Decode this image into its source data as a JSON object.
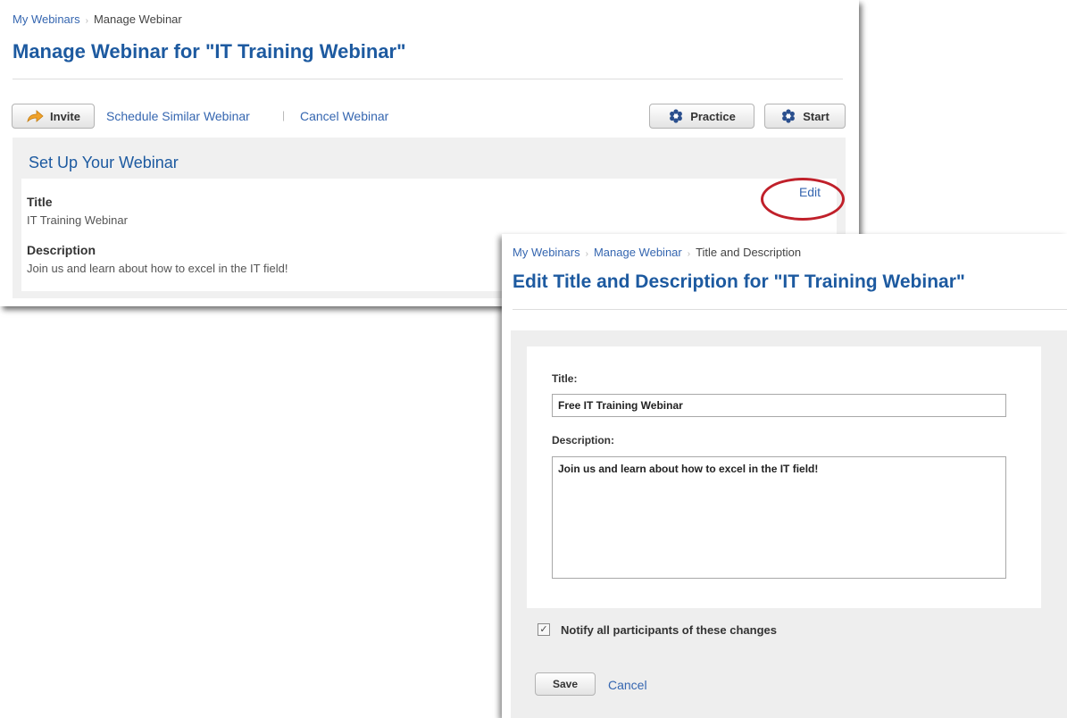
{
  "manage_panel": {
    "breadcrumb": {
      "home": "My Webinars",
      "current": "Manage Webinar",
      "separator": "›"
    },
    "title": "Manage Webinar for \"IT Training Webinar\"",
    "toolbar": {
      "invite_label": "Invite",
      "schedule_similar_label": "Schedule Similar Webinar",
      "link_separator": "|",
      "cancel_webinar_label": "Cancel Webinar",
      "practice_label": "Practice",
      "start_label": "Start"
    },
    "setup": {
      "heading": "Set Up Your Webinar",
      "title_label": "Title",
      "title_value": "IT Training Webinar",
      "description_label": "Description",
      "description_value": "Join us and learn about how to excel in the IT field!",
      "edit_label": "Edit"
    }
  },
  "edit_panel": {
    "breadcrumb": {
      "home": "My Webinars",
      "manage": "Manage Webinar",
      "current": "Title and Description",
      "separator": "›"
    },
    "title": "Edit Title and Description for \"IT Training Webinar\"",
    "form": {
      "title_label": "Title:",
      "title_value": "Free IT Training Webinar",
      "description_label": "Description:",
      "description_value": "Join us and learn about how to excel in the IT field!",
      "notify_label": "Notify all participants of these changes",
      "notify_checked": true,
      "notify_check_glyph": "✓",
      "save_label": "Save",
      "cancel_label": "Cancel"
    }
  },
  "colors": {
    "link": "#3566b0",
    "heading": "#1d5aa0",
    "highlight_circle": "#c0202a",
    "invite_arrow": "#f0a22a",
    "gear": "#2a4f8e"
  },
  "icons": {
    "invite": "arrow-icon",
    "practice": "gear-icon",
    "start": "gear-icon"
  }
}
